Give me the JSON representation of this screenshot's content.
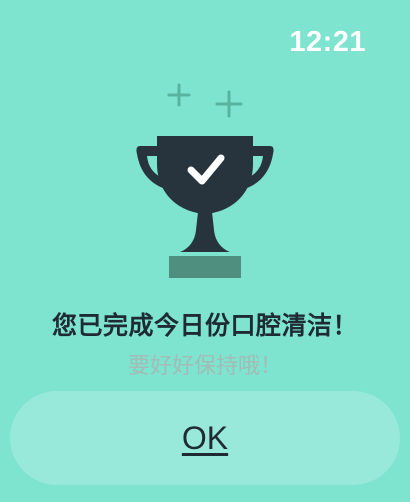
{
  "status_bar": {
    "time": "12:21"
  },
  "dialog": {
    "illustration_icon": "trophy-with-checkmark-icon",
    "title": "您已完成今日份口腔清洁！",
    "subtitle": "要好好保持哦！",
    "ok_label": "OK"
  },
  "colors": {
    "background": "#7ee3cf",
    "trophy": "#27343d",
    "trophy_base": "#4e8f7f",
    "sparkle": "#58b49f",
    "title_text": "#1f2b33",
    "subtitle_text": "#a2bcb6",
    "button_bg": "#98e9d9"
  }
}
